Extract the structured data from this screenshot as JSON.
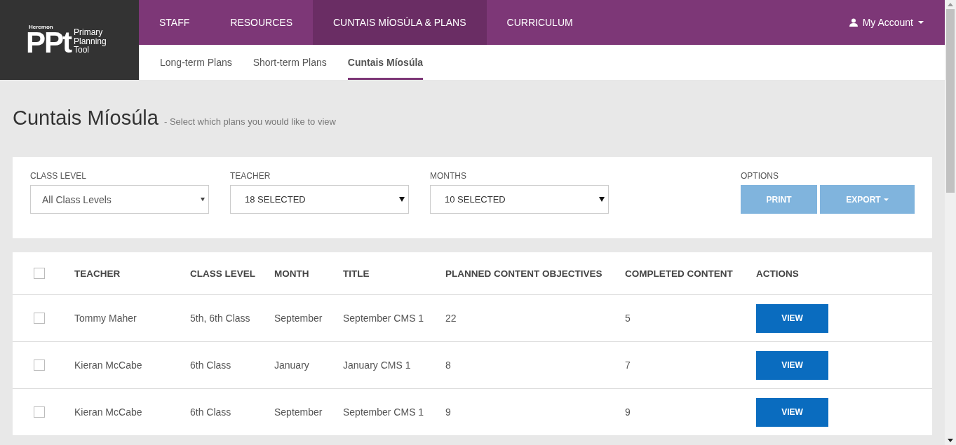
{
  "logo": {
    "brand": "Heremon",
    "mark": "PPt",
    "name": "Primary Planning Tool"
  },
  "nav": [
    {
      "label": "STAFF",
      "selected": false
    },
    {
      "label": "RESOURCES",
      "selected": false
    },
    {
      "label": "CUNTAIS MÍOSÚLA & PLANS",
      "selected": true
    },
    {
      "label": "CURRICULUM",
      "selected": false
    }
  ],
  "account": {
    "label": "My Account"
  },
  "subnav": [
    {
      "label": "Long-term Plans",
      "selected": false
    },
    {
      "label": "Short-term Plans",
      "selected": false
    },
    {
      "label": "Cuntais Míosúla",
      "selected": true
    }
  ],
  "page": {
    "title": "Cuntais Míosúla",
    "subtitle": "- Select which plans you would like to view"
  },
  "filters": [
    {
      "label": "CLASS LEVEL",
      "value": "All Class Levels",
      "kind": "plain"
    },
    {
      "label": "TEACHER",
      "value": "18 SELECTED",
      "kind": "multi"
    },
    {
      "label": "MONTHS",
      "value": "10 SELECTED",
      "kind": "multi"
    }
  ],
  "options": {
    "label": "OPTIONS",
    "buttons": [
      {
        "label": "PRINT",
        "disabled": true,
        "kind": "button"
      },
      {
        "label": "EXPORT",
        "disabled": true,
        "kind": "dropdown"
      }
    ]
  },
  "table": {
    "select_all": {
      "checked": false
    },
    "columns": [
      "TEACHER",
      "CLASS LEVEL",
      "MONTH",
      "TITLE",
      "PLANNED CONTENT OBJECTIVES",
      "COMPLETED CONTENT",
      "ACTIONS"
    ],
    "rows": [
      {
        "checked": false,
        "cells": [
          "Tommy Maher",
          "5th, 6th Class",
          "September",
          "September CMS 1",
          "22",
          "5"
        ],
        "action": "VIEW"
      },
      {
        "checked": false,
        "cells": [
          "Kieran McCabe",
          "6th Class",
          "January",
          "January CMS 1",
          "8",
          "7"
        ],
        "action": "VIEW"
      },
      {
        "checked": false,
        "cells": [
          "Kieran McCabe",
          "6th Class",
          "September",
          "September CMS 1",
          "9",
          "9"
        ],
        "action": "VIEW"
      }
    ]
  }
}
